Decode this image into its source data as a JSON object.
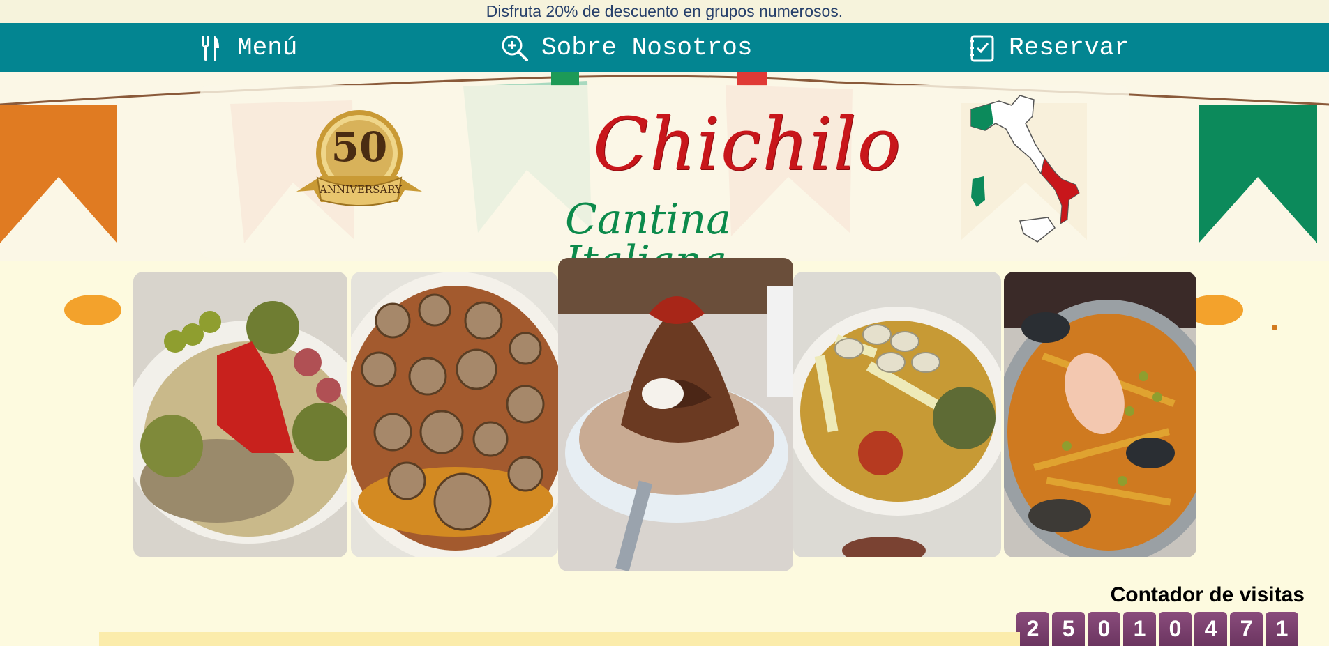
{
  "promo": {
    "text": "Disfruta 20% de descuento en grupos numerosos."
  },
  "nav": {
    "items": [
      {
        "label": "Menú",
        "icon": "fork-knife-icon"
      },
      {
        "label": "Sobre Nosotros",
        "icon": "magnify-plus-icon"
      },
      {
        "label": "Reservar",
        "icon": "checklist-icon"
      }
    ]
  },
  "hero": {
    "badge_number": "50",
    "badge_text": "ANNIVERSARY",
    "brand_name": "Chichilo",
    "brand_subtitle": "Cantina Italiana",
    "colors": {
      "orange": "#e07b22",
      "green": "#0c8a5b",
      "pink": "#f0b7ab",
      "red": "#c8161b"
    }
  },
  "gallery": {
    "images": [
      {
        "name": "antipasto-plate-image"
      },
      {
        "name": "snails-in-sauce-image"
      },
      {
        "name": "dessert-plate-image"
      },
      {
        "name": "vegetables-plate-image"
      },
      {
        "name": "paella-image"
      }
    ]
  },
  "visit_counter": {
    "title": "Contador de visitas",
    "digits": [
      "2",
      "5",
      "0",
      "1",
      "0",
      "4",
      "7",
      "1"
    ]
  }
}
